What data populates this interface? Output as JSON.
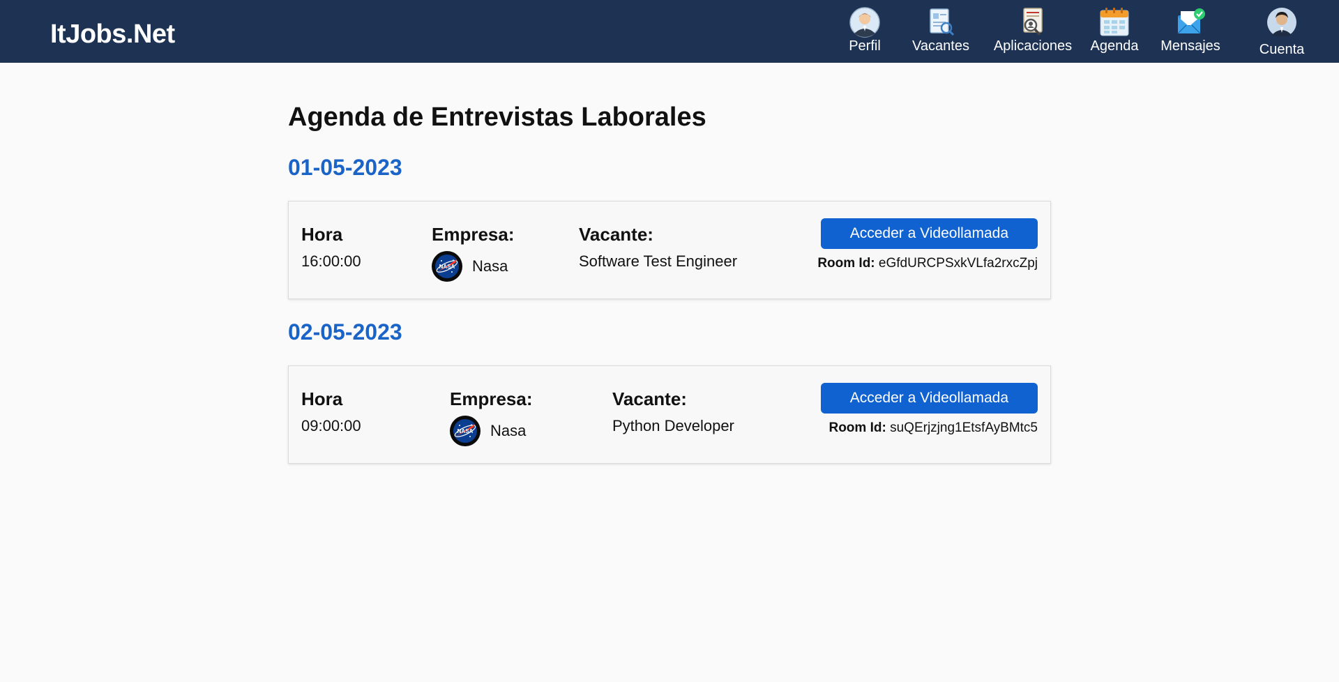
{
  "app": {
    "brand": "ItJobs.Net"
  },
  "nav": {
    "items": [
      {
        "label": "Perfil",
        "icon": "profile-icon"
      },
      {
        "label": "Vacantes",
        "icon": "vacancies-icon"
      },
      {
        "label": "Aplicaciones",
        "icon": "applications-icon"
      },
      {
        "label": "Agenda",
        "icon": "calendar-icon"
      },
      {
        "label": "Mensajes",
        "icon": "messages-icon"
      },
      {
        "label": "Cuenta",
        "icon": "account-avatar-icon"
      }
    ]
  },
  "page": {
    "title": "Agenda de Entrevistas Laborales"
  },
  "labels": {
    "hora": "Hora",
    "empresa": "Empresa:",
    "vacante": "Vacante:",
    "button": "Acceder a Videollamada",
    "room_id": "Room Id:"
  },
  "interviews": [
    {
      "date": "01-05-2023",
      "time": "16:00:00",
      "company": "Nasa",
      "company_icon": "nasa-logo-icon",
      "vacancy": "Software Test Engineer",
      "room_id": "eGfdURCPSxkVLfa2rxcZpj"
    },
    {
      "date": "02-05-2023",
      "time": "09:00:00",
      "company": "Nasa",
      "company_icon": "nasa-logo-icon",
      "vacancy": "Python Developer",
      "room_id": "suQErjzjng1EtsfAyBMtc5"
    }
  ],
  "colors": {
    "navbar": "#1e3354",
    "accent": "#1a63c7",
    "button": "#0f62cf",
    "background": "#fafafa"
  }
}
